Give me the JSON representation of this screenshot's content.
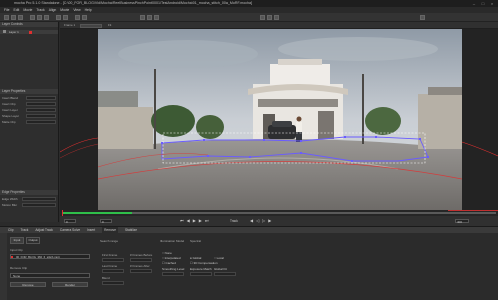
{
  "window": {
    "title": "mocha Pro 5.1.0 Standalone - [C:\\00_FOR_BLOG\\Vid\\Mocha\\ReelBusinessPinchPoint0001\\TestAndroid\\Mocha\\01_mocha_stitch_00a_MoRF.mocha]"
  },
  "menu": [
    "File",
    "Edit",
    "Movie",
    "Track",
    "Align",
    "Movie",
    "View",
    "Help"
  ],
  "left_panel": {
    "layers_header": "Layer Controls",
    "layer_name": "Layer 1",
    "layer_props_header": "Layer Properties",
    "fields": [
      "Insert Blend",
      "Insert Clip",
      "Insert Layer",
      "Shape Layer",
      "Matte Clip"
    ],
    "params_header": "Edge Properties",
    "edge_width_label": "Edge Width",
    "motion_blur_label": "Motion Blur"
  },
  "viewer_bar": {
    "view_label": "Frame 1",
    "zoom": "Fit"
  },
  "transport": {
    "frame_in": "0",
    "frame_current": "0",
    "frame_out": "400",
    "track_label": "Track"
  },
  "bottom_tabs": [
    "Clip",
    "Track",
    "Adjust Track",
    "Camera Solve",
    "Insert",
    "Remove",
    "Stabilize"
  ],
  "bottom_panel": {
    "input_label": "Input",
    "output_label": "Output",
    "input_clip_label": "Input Clip",
    "clip_name": "00_FOR_BLOG_360_6_stitch.mp4",
    "remove_clip_label": "Remove Clip",
    "none_value": "None",
    "remove_button": "Remove",
    "render_label": "Render",
    "search_range_label": "Search range",
    "first_frame_label": "First Frame",
    "last_frame_label": "Last Frame",
    "blend_label": "Blend",
    "frames_before": "# Frames Before",
    "frames_after": "# Frames After",
    "illumination_label": "Illumination Model",
    "illum_options": [
      "None",
      "Global",
      "Local"
    ],
    "smoothing_label": "Smoothing Level",
    "spectral_label": "Spectral",
    "options": [
      "Interpolated",
      "Cached",
      "3D Compensation",
      "Global Fit",
      "Exposure Match"
    ]
  },
  "colors": {
    "accent": "#e03030",
    "track_dot": "#7070ff",
    "bg": "#2b2b2b"
  }
}
